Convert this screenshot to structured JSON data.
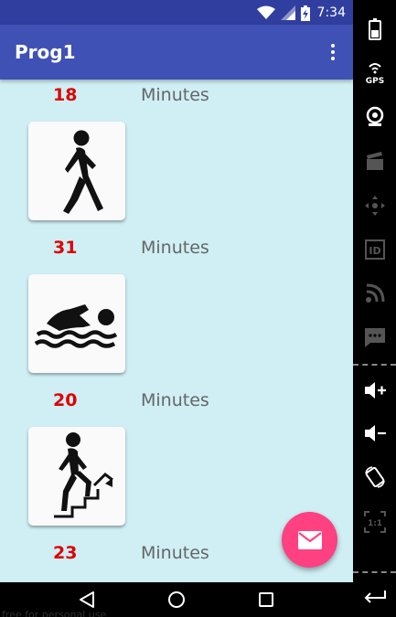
{
  "status_bar": {
    "time": "7:34",
    "icons": [
      "wifi-icon",
      "cell-signal-icon",
      "battery-charging-icon"
    ]
  },
  "app_bar": {
    "title": "Prog1",
    "overflow_icon": "more-vert-icon"
  },
  "activities": [
    {
      "icon": null,
      "minutes": "18",
      "label": "Minutes"
    },
    {
      "icon": "walking-icon",
      "minutes": "31",
      "label": "Minutes"
    },
    {
      "icon": "swimming-icon",
      "minutes": "20",
      "label": "Minutes"
    },
    {
      "icon": "stair-climbing-icon",
      "minutes": "23",
      "label": "Minutes"
    }
  ],
  "fab": {
    "icon": "email-icon",
    "color": "#ff4081"
  },
  "nav_bar": {
    "buttons": [
      "back-icon",
      "home-icon",
      "recents-icon"
    ]
  },
  "watermark": "free for personal use",
  "emulator_toolbar": {
    "buttons": [
      "battery-icon",
      "gps-icon",
      "camera-icon",
      "clapperboard-icon",
      "dpad-icon",
      "id-icon",
      "rss-icon",
      "sms-icon",
      "volume-up-icon",
      "volume-down-icon",
      "rotate-icon",
      "scale-icon",
      "return-icon"
    ],
    "gps_label": "GPS",
    "id_label": "ID",
    "scale_label": "1:1"
  },
  "colors": {
    "status_bar": "#303f9f",
    "app_bar": "#3f51b5",
    "content_background": "#cfeff5",
    "minutes_value": "#e00000",
    "minutes_label": "#666666",
    "fab": "#ff4081"
  }
}
